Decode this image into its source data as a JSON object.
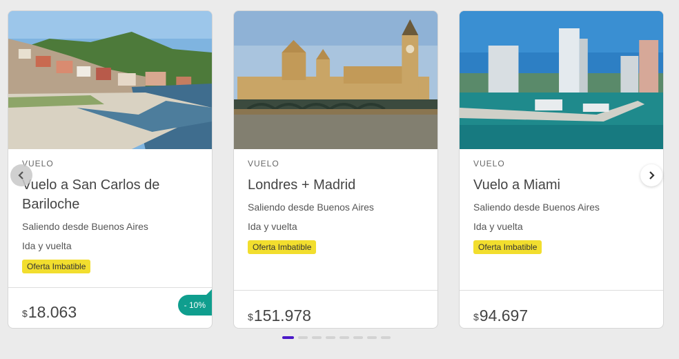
{
  "cards": [
    {
      "type": "VUELO",
      "title": "Vuelo a San Carlos de Bariloche",
      "departure": "Saliendo desde Buenos Aires",
      "trip": "Ida y vuelta",
      "badge": "Oferta Imbatible",
      "currency": "$",
      "price": "18.063",
      "discount": "- 10%"
    },
    {
      "type": "VUELO",
      "title": "Londres + Madrid",
      "departure": "Saliendo desde Buenos Aires",
      "trip": "Ida y vuelta",
      "badge": "Oferta Imbatible",
      "currency": "$",
      "price": "151.978"
    },
    {
      "type": "VUELO",
      "title": "Vuelo a Miami",
      "departure": "Saliendo desde Buenos Aires",
      "trip": "Ida y vuelta",
      "badge": "Oferta Imbatible",
      "currency": "$",
      "price": "94.697"
    }
  ],
  "carousel": {
    "slide_count": 8,
    "active_index": 0
  },
  "colors": {
    "badge": "#f2de2e",
    "discount": "#0f9e8e",
    "active_dot": "#4b19c8"
  },
  "icons": {
    "prev": "chevron-left-icon",
    "next": "chevron-right-icon"
  }
}
